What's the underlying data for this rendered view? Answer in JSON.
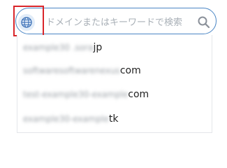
{
  "search": {
    "placeholder": "ドメインまたはキーワードで検索",
    "value": ""
  },
  "suggestions": [
    {
      "blurred": "example30 .sora",
      "suffix": "jp"
    },
    {
      "blurred": "softwaresoftwarenexus",
      "suffix": "com"
    },
    {
      "blurred": "test-example30-example",
      "suffix": "com"
    },
    {
      "blurred": "example30-example",
      "suffix": "tk"
    }
  ],
  "icons": {
    "globe": "globe-icon",
    "search": "search-icon"
  },
  "colors": {
    "accent": "#4a86c5",
    "highlight": "#d9252a"
  }
}
